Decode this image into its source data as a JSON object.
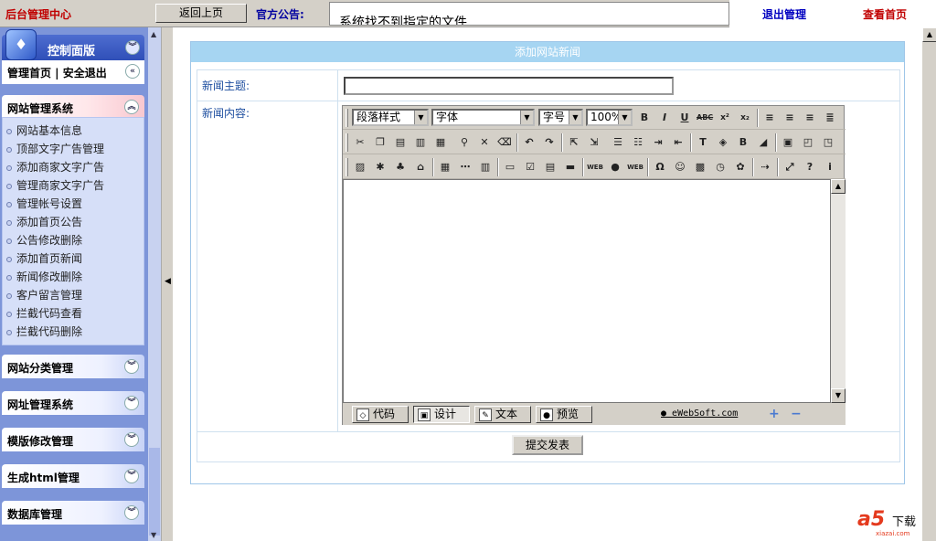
{
  "header": {
    "brand": "后台管理中心",
    "back_button": "返回上页",
    "notice_label": "官方公告:",
    "notice_text": "系统找不到指定的文件",
    "logout": "退出管理",
    "view_home": "查看首页"
  },
  "sidebar": {
    "panel_title": "控制面版",
    "panel_logo": "♦",
    "quick_links": "管理首页 | 安全退出",
    "sections": [
      {
        "label": "网站管理系统",
        "expanded": true
      },
      {
        "label": "网站分类管理",
        "expanded": false
      },
      {
        "label": "网址管理系统",
        "expanded": false
      },
      {
        "label": "模版修改管理",
        "expanded": false
      },
      {
        "label": "生成html管理",
        "expanded": false
      },
      {
        "label": "数据库管理",
        "expanded": false
      }
    ],
    "items": [
      {
        "label": "网站基本信息"
      },
      {
        "label": "顶部文字广告管理"
      },
      {
        "label": "添加商家文字广告"
      },
      {
        "label": "管理商家文字广告"
      },
      {
        "label": "管理帐号设置"
      },
      {
        "label": "添加首页公告"
      },
      {
        "label": "公告修改删除"
      },
      {
        "label": "添加首页新闻"
      },
      {
        "label": "新闻修改删除"
      },
      {
        "label": "客户留言管理"
      },
      {
        "label": "拦截代码查看"
      },
      {
        "label": "拦截代码删除"
      }
    ]
  },
  "form": {
    "header": "添加网站新闻",
    "title_label": "新闻主题:",
    "title_value": "",
    "content_label": "新闻内容:",
    "submit": "提交发表"
  },
  "editor": {
    "paragraph_style": "段落样式",
    "font": "字体",
    "font_size": "字号",
    "zoom": "100%",
    "mode_buttons": [
      {
        "label": "代码",
        "icon": "code-icon"
      },
      {
        "label": "设计",
        "icon": "design-icon",
        "active": true
      },
      {
        "label": "文本",
        "icon": "text-icon"
      },
      {
        "label": "预览",
        "icon": "preview-icon"
      }
    ],
    "brand_link": "eWebSoft.com"
  },
  "watermark": {
    "logo": "a5",
    "text": "下载",
    "url": "xiazai.com"
  },
  "colors": {
    "brand_red": "#c00000",
    "link_blue": "#0000c0",
    "sidebar_bg": "#7d95d9",
    "form_header": "#a6d5f2"
  }
}
